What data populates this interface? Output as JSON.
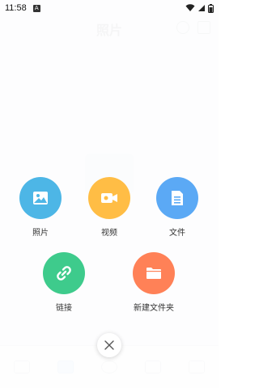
{
  "status_bar": {
    "time": "11:58",
    "notification_glyph": "A",
    "icons": [
      "wifi-icon",
      "signal-icon",
      "battery-icon"
    ]
  },
  "header": {
    "title": "照片"
  },
  "colors": {
    "photos": "#4db6e6",
    "video": "#ffbd45",
    "file": "#5ba9f5",
    "link": "#3ecb8c",
    "new_folder": "#ff8157"
  },
  "menu": {
    "items": [
      {
        "label": "照片",
        "icon": "image-icon"
      },
      {
        "label": "视频",
        "icon": "video-camera-icon"
      },
      {
        "label": "文件",
        "icon": "document-icon"
      },
      {
        "label": "链接",
        "icon": "link-icon"
      },
      {
        "label": "新建文件夹",
        "icon": "folder-icon"
      }
    ]
  },
  "close": {
    "icon": "close-icon"
  }
}
